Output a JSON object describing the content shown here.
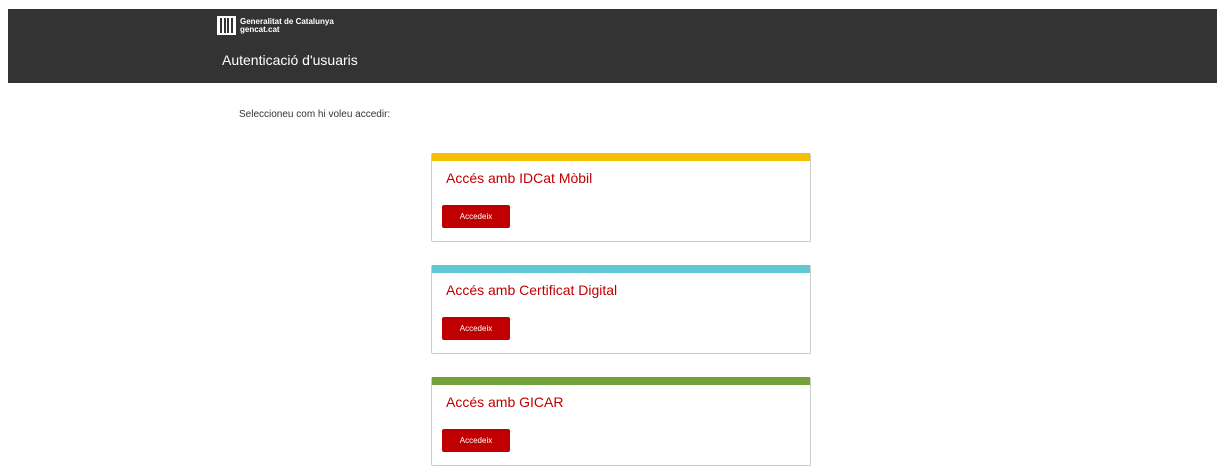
{
  "header": {
    "logo": {
      "icon": "generalitat-logo-icon",
      "line1": "Generalitat de Catalunya",
      "line2": "gencat.cat"
    },
    "title": "Autenticació d'usuaris"
  },
  "intro_text": "Seleccioneu com hi voleu accedir:",
  "colors": {
    "header_bg": "#333333",
    "accent_red": "#c00000",
    "idcat_bar": "#f5be00",
    "certificat_bar": "#5ec8d3",
    "gicar_bar": "#74a23a"
  },
  "options": [
    {
      "title": "Accés amb IDCat Mòbil",
      "button_label": "Accedeix",
      "bar_color": "#f5be00"
    },
    {
      "title": "Accés amb Certificat Digital",
      "button_label": "Accedeix",
      "bar_color": "#5ec8d3"
    },
    {
      "title": "Accés amb GICAR",
      "button_label": "Accedeix",
      "bar_color": "#74a23a"
    }
  ]
}
